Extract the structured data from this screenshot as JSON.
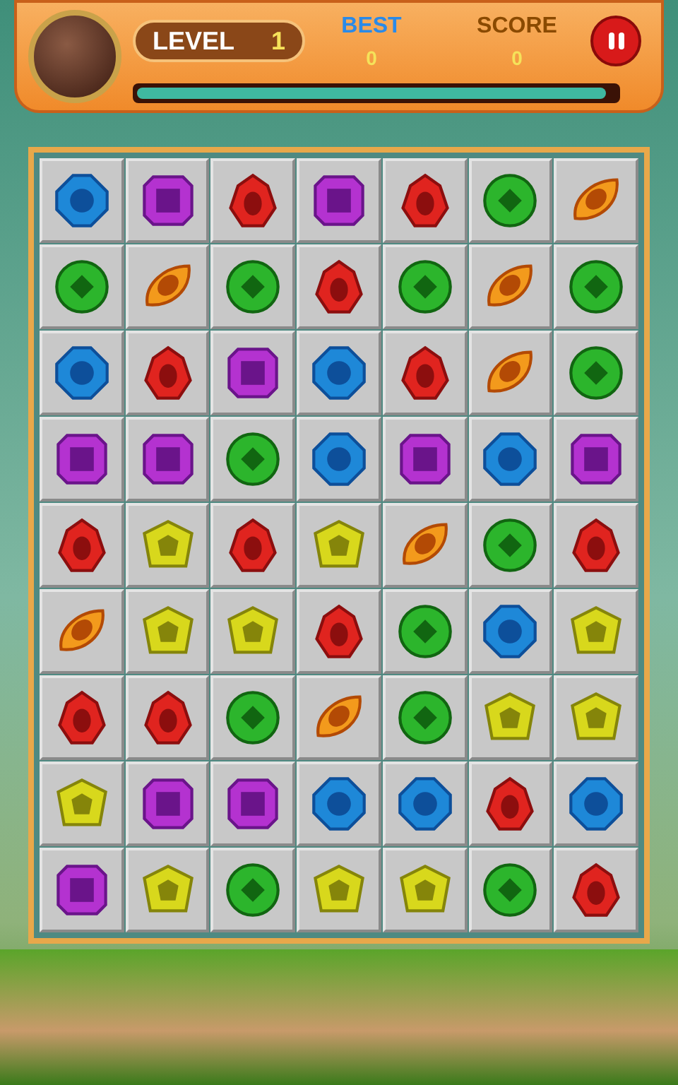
{
  "header": {
    "level_label": "LEVEL",
    "level_value": "1",
    "best_label": "BEST",
    "best_value": "0",
    "score_label": "SCORE",
    "score_value": "0"
  },
  "progress": {
    "level": 0.98
  },
  "board": [
    [
      {
        "kind": "octagon"
      },
      {
        "kind": "square"
      },
      {
        "kind": "drop"
      },
      {
        "kind": "square"
      },
      {
        "kind": "drop"
      },
      {
        "kind": "circle"
      },
      {
        "kind": "leaf"
      }
    ],
    [
      {
        "kind": "circle"
      },
      {
        "kind": "leaf"
      },
      {
        "kind": "circle"
      },
      {
        "kind": "drop"
      },
      {
        "kind": "circle"
      },
      {
        "kind": "leaf"
      },
      {
        "kind": "circle"
      }
    ],
    [
      {
        "kind": "octagon"
      },
      {
        "kind": "drop"
      },
      {
        "kind": "square"
      },
      {
        "kind": "octagon"
      },
      {
        "kind": "drop"
      },
      {
        "kind": "leaf"
      },
      {
        "kind": "circle"
      }
    ],
    [
      {
        "kind": "square"
      },
      {
        "kind": "square"
      },
      {
        "kind": "circle"
      },
      {
        "kind": "octagon"
      },
      {
        "kind": "square"
      },
      {
        "kind": "octagon"
      },
      {
        "kind": "square"
      }
    ],
    [
      {
        "kind": "drop"
      },
      {
        "kind": "pentagon"
      },
      {
        "kind": "drop"
      },
      {
        "kind": "pentagon"
      },
      {
        "kind": "leaf"
      },
      {
        "kind": "circle"
      },
      {
        "kind": "drop"
      }
    ],
    [
      {
        "kind": "leaf"
      },
      {
        "kind": "pentagon"
      },
      {
        "kind": "pentagon"
      },
      {
        "kind": "drop"
      },
      {
        "kind": "circle"
      },
      {
        "kind": "octagon"
      },
      {
        "kind": "pentagon"
      }
    ],
    [
      {
        "kind": "drop"
      },
      {
        "kind": "drop"
      },
      {
        "kind": "circle"
      },
      {
        "kind": "leaf"
      },
      {
        "kind": "circle"
      },
      {
        "kind": "pentagon"
      },
      {
        "kind": "pentagon"
      }
    ],
    [
      {
        "kind": "pentagon"
      },
      {
        "kind": "square"
      },
      {
        "kind": "square"
      },
      {
        "kind": "octagon"
      },
      {
        "kind": "octagon"
      },
      {
        "kind": "drop"
      },
      {
        "kind": "octagon"
      }
    ],
    [
      {
        "kind": "square"
      },
      {
        "kind": "pentagon"
      },
      {
        "kind": "circle"
      },
      {
        "kind": "pentagon"
      },
      {
        "kind": "pentagon"
      },
      {
        "kind": "circle"
      },
      {
        "kind": "drop"
      }
    ]
  ]
}
